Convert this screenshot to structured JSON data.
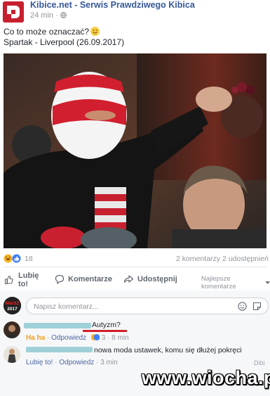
{
  "post": {
    "page_name": "Kibice.net - Serwis Prawdziwego Kibica",
    "time": "24 min",
    "privacy_icon": "globe-icon",
    "text_line1": "Co to może oznaczać?",
    "text_line2": "Spartak - Liverpool (26.09.2017)",
    "avatar_logo_text": "KIBICE"
  },
  "stats": {
    "reaction_icons": [
      "haha-icon",
      "like-icon"
    ],
    "reaction_count": "18",
    "comments_shares": "2 komentarzy  2 udostępnień"
  },
  "actions": {
    "like_line1": "Lubię",
    "like_line2": "to!",
    "comment": "Komentarze",
    "share": "Udostępnij",
    "sort": "Najlepsze komentarze"
  },
  "composer": {
    "placeholder": "Napisz komentarz...",
    "avatar_text_1": "MarSZ",
    "avatar_text_2": "2017"
  },
  "comments": [
    {
      "text": "Autyzm?",
      "reaction_label": "Ha ha",
      "reply": "Odpowiedz",
      "reaction_count": "3",
      "time": "8 min"
    },
    {
      "text": "nowa moda ustawek, komu się dłużej pokręci",
      "like": "Lubię to!",
      "reply": "Odpowiedz",
      "time": "3 min",
      "watermark_small": "Dibi"
    }
  ],
  "watermark": "www.wiocha.pl",
  "colors": {
    "link_blue": "#365899",
    "meta_gray": "#90949c",
    "haha_yellow": "#f7b125",
    "like_blue": "#4080ff",
    "underline_red": "#d0202a"
  }
}
